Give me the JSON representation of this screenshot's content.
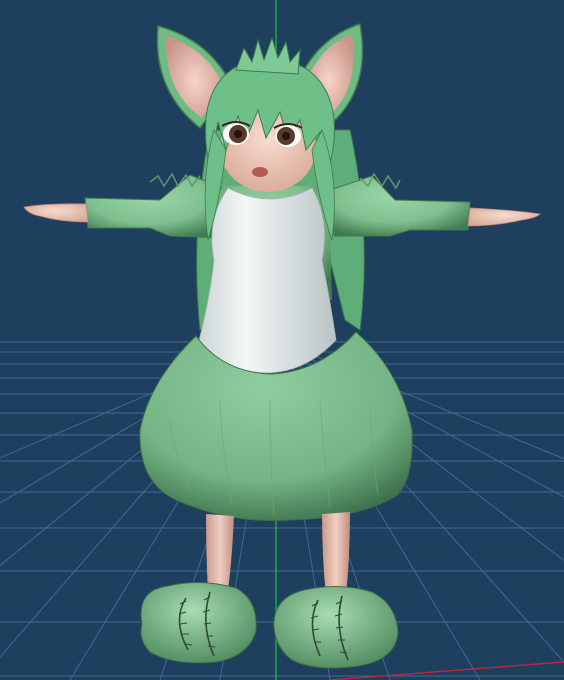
{
  "viewport": {
    "background": "#1f3f5e",
    "grid_color": "#3d6b96",
    "axis_y_color": "#19c23c",
    "axis_x_color": "#c0263c",
    "projection": "perspective"
  },
  "model": {
    "pose": "T-pose",
    "palette": {
      "fur": "#7fc08e",
      "fur_dark": "#4f8a5f",
      "apron": "#eef2f2",
      "skin": "#f0c9b8",
      "ear_inner": "#f0c4b6",
      "legs": "#e8c2b4"
    },
    "parts": [
      "ears",
      "hair",
      "head",
      "face",
      "sleeves",
      "hands",
      "apron",
      "skirt",
      "legs",
      "slippers"
    ]
  }
}
